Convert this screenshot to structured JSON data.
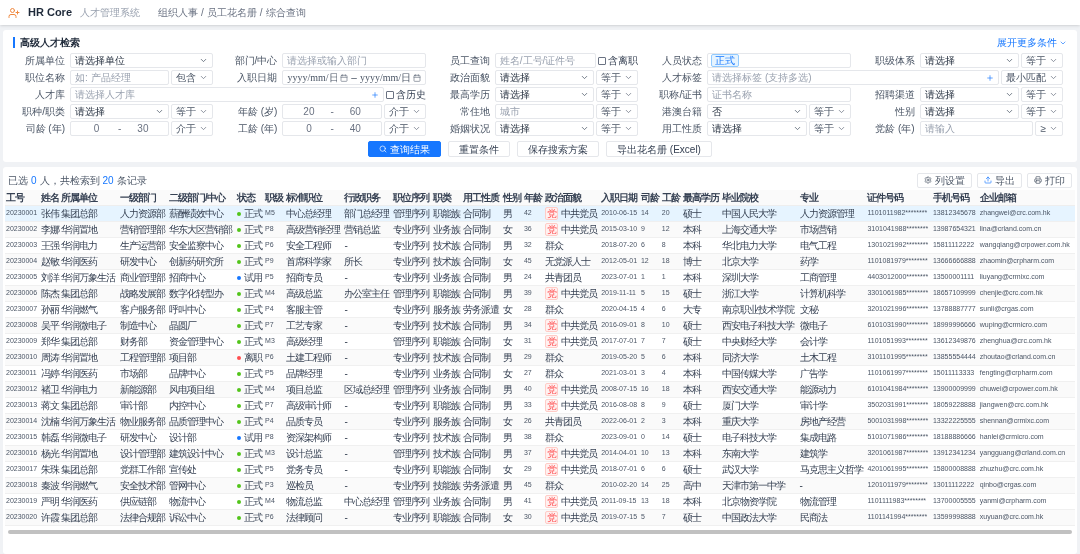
{
  "header": {
    "product": "HR Core",
    "subtitle": "人才管理系统",
    "breadcrumb": [
      "组织人事",
      "员工花名册",
      "综合查询"
    ],
    "separator": "/"
  },
  "search": {
    "title": "高级人才检索",
    "expand_link": "展开更多条件",
    "fields": [
      {
        "label": "所属单位",
        "kind": "select",
        "value": "请选择单位"
      },
      {
        "label": "部门/中心",
        "kind": "input",
        "placeholder": "请选择或输入部门"
      },
      {
        "label": "员工查询",
        "kind": "input",
        "placeholder": "姓名/工号/证件号",
        "checkbox": {
          "label": "含离职",
          "checked": false
        }
      },
      {
        "label": "人员状态",
        "kind": "tags",
        "tags": [
          "正式"
        ]
      },
      {
        "label": "职级体系",
        "kind": "select",
        "value": "请选择",
        "operator": "等于"
      },
      {
        "label": "职位名称",
        "kind": "input",
        "placeholder": "如: 产品经理",
        "operator": "包含"
      },
      {
        "label": "入职日期",
        "kind": "date_range",
        "from_placeholder": "yyyy/mm/日",
        "to_placeholder": "yyyy/mm/日",
        "separator": "–"
      },
      {
        "label": "政治面貌",
        "kind": "select",
        "value": "请选择",
        "operator": "等于"
      },
      {
        "label": "人才标签",
        "kind": "picker",
        "placeholder": "请选择标签 (支持多选)",
        "operator": "最小匹配",
        "wide": true
      },
      {
        "label": "人才库",
        "kind": "picker",
        "placeholder": "请选择人才库",
        "wide": true,
        "checkbox": {
          "label": "含历史",
          "checked": false
        }
      },
      {
        "label": "最高学历",
        "kind": "select",
        "value": "请选择",
        "operator": "等于"
      },
      {
        "label": "职称/证书",
        "kind": "input",
        "placeholder": "证书名称"
      },
      {
        "label": "招聘渠道",
        "kind": "select",
        "value": "请选择",
        "operator": "等于"
      },
      {
        "label": "职种/职类",
        "kind": "select",
        "value": "请选择",
        "operator": "等于"
      },
      {
        "label": "年龄 (岁)",
        "kind": "num_range",
        "from_placeholder": "20",
        "to_placeholder": "60",
        "separator": "-",
        "operator": "介于"
      },
      {
        "label": "常住地",
        "kind": "input",
        "placeholder": "城市",
        "operator": "等于"
      },
      {
        "label": "港澳台籍",
        "kind": "select",
        "value": "否",
        "operator": "等于"
      },
      {
        "label": "性别",
        "kind": "select",
        "value": "请选择",
        "operator": "等于"
      },
      {
        "label": "司龄 (年)",
        "kind": "num_range",
        "from_placeholder": "0",
        "to_placeholder": "30",
        "separator": "-",
        "operator": "介于"
      },
      {
        "label": "工龄 (年)",
        "kind": "num_range",
        "from_placeholder": "0",
        "to_placeholder": "40",
        "separator": "-",
        "operator": "介于"
      },
      {
        "label": "婚姻状况",
        "kind": "select",
        "value": "请选择",
        "operator": "等于"
      },
      {
        "label": "用工性质",
        "kind": "select",
        "value": "请选择",
        "operator": "等于"
      },
      {
        "label": "党龄 (年)",
        "kind": "input",
        "placeholder": "请输入",
        "operator": "≥"
      }
    ],
    "buttons": [
      {
        "label": "查询结果",
        "kind": "primary"
      },
      {
        "label": "重置条件",
        "kind": "default"
      },
      {
        "label": "保存搜索方案",
        "kind": "default"
      },
      {
        "label": "导出花名册 (Excel)",
        "kind": "default"
      }
    ]
  },
  "results": {
    "summary": {
      "prefix": "已选",
      "selected_count": "0",
      "middle": "人，共检索到",
      "total": "20",
      "suffix": "条记录"
    },
    "tools": [
      {
        "label": "列设置",
        "kind": "settings"
      },
      {
        "label": "导出",
        "kind": "export"
      },
      {
        "label": "打印",
        "kind": "print"
      }
    ],
    "columns": [
      {
        "label": "工号",
        "kind": "number"
      },
      {
        "label": "姓名",
        "kind": "text"
      },
      {
        "label": "所属单位",
        "kind": "text"
      },
      {
        "label": "一级部门",
        "kind": "text"
      },
      {
        "label": "二级部门/中心",
        "kind": "text"
      },
      {
        "label": "状态",
        "kind": "status"
      },
      {
        "label": "职级",
        "kind": "number"
      },
      {
        "label": "标准职位",
        "kind": "text"
      },
      {
        "label": "行政职务",
        "kind": "text"
      },
      {
        "label": "职位序列",
        "kind": "text"
      },
      {
        "label": "职类",
        "kind": "text"
      },
      {
        "label": "用工性质",
        "kind": "text"
      },
      {
        "label": "性别",
        "kind": "text"
      },
      {
        "label": "年龄",
        "kind": "number"
      },
      {
        "label": "政治面貌",
        "kind": "political"
      },
      {
        "label": "入职日期",
        "kind": "number"
      },
      {
        "label": "司龄",
        "kind": "number"
      },
      {
        "label": "工龄",
        "kind": "number"
      },
      {
        "label": "最高学历",
        "kind": "text"
      },
      {
        "label": "毕业院校",
        "kind": "text"
      },
      {
        "label": "专业",
        "kind": "text"
      },
      {
        "label": "证件号码",
        "kind": "number"
      },
      {
        "label": "手机号码",
        "kind": "number"
      },
      {
        "label": "企业邮箱",
        "kind": "number"
      }
    ],
    "rows": [
      {
        "selected": true,
        "cells": [
          "20230001",
          "张伟",
          "集团总部",
          "人力资源部",
          "薪酬绩效中心",
          {
            "text": "正式",
            "color": "#52c41a"
          },
          "M5",
          "中心总经理",
          "部门总经理",
          "管理序列",
          "职能族",
          "合同制",
          "男",
          "42",
          {
            "text": "中共党员",
            "badge": "党"
          },
          "2010-06-15",
          "14",
          "20",
          "硕士",
          "中国人民大学",
          "人力资源管理",
          "1101011982********",
          "13812345678",
          "zhangwei@crc.com.hk"
        ]
      },
      {
        "selected": false,
        "cells": [
          "20230002",
          "李娜",
          "华润置地",
          "营销管理部",
          "华东大区营销部",
          {
            "text": "正式",
            "color": "#52c41a"
          },
          "P8",
          "高级营销经理",
          "营销总监",
          "专业序列",
          "业务族",
          "合同制",
          "女",
          "36",
          {
            "text": "中共党员",
            "badge": "党"
          },
          "2015-03-10",
          "9",
          "12",
          "本科",
          "上海交通大学",
          "市场营销",
          "3101041988********",
          "13987654321",
          "lina@crland.com.cn"
        ]
      },
      {
        "selected": false,
        "cells": [
          "20230003",
          "王强",
          "华润电力",
          "生产运营部",
          "安全监察中心",
          {
            "text": "正式",
            "color": "#52c41a"
          },
          "P6",
          "安全工程师",
          "-",
          "专业序列",
          "技术族",
          "合同制",
          "男",
          "32",
          {
            "text": "群众"
          },
          "2018-07-20",
          "6",
          "8",
          "本科",
          "华北电力大学",
          "电气工程",
          "1301021992********",
          "15811112222",
          "wangqiang@crpower.com.hk"
        ]
      },
      {
        "selected": false,
        "cells": [
          "20230004",
          "赵敏",
          "华润医药",
          "研发中心",
          "创新药研究所",
          {
            "text": "正式",
            "color": "#52c41a"
          },
          "P9",
          "首席科学家",
          "所长",
          "专业序列",
          "技术族",
          "合同制",
          "女",
          "45",
          {
            "text": "无党派人士"
          },
          "2012-05-01",
          "12",
          "18",
          "博士",
          "北京大学",
          "药学",
          "1101081979********",
          "13666666888",
          "zhaomin@crpharm.com"
        ]
      },
      {
        "selected": false,
        "cells": [
          "20230005",
          "刘洋",
          "华润万象生活",
          "商业管理部",
          "招商中心",
          {
            "text": "试用",
            "color": "#1677ff"
          },
          "P5",
          "招商专员",
          "-",
          "专业序列",
          "业务族",
          "合同制",
          "男",
          "24",
          {
            "text": "共青团员"
          },
          "2023-07-01",
          "1",
          "1",
          "本科",
          "深圳大学",
          "工商管理",
          "4403012000********",
          "13500001111",
          "liuyang@crmixc.com"
        ]
      },
      {
        "selected": false,
        "cells": [
          "20230006",
          "陈杰",
          "集团总部",
          "战略发展部",
          "数字化转型办",
          {
            "text": "正式",
            "color": "#52c41a"
          },
          "M4",
          "高级总监",
          "办公室主任",
          "管理序列",
          "职能族",
          "合同制",
          "男",
          "39",
          {
            "text": "中共党员",
            "badge": "党"
          },
          "2019-11-11",
          "5",
          "15",
          "硕士",
          "浙江大学",
          "计算机科学",
          "3301061985********",
          "18657109999",
          "chenjie@crc.com.hk"
        ]
      },
      {
        "selected": false,
        "cells": [
          "20230007",
          "孙丽",
          "华润燃气",
          "客户服务部",
          "呼叫中心",
          {
            "text": "正式",
            "color": "#52c41a"
          },
          "P4",
          "客服主管",
          "-",
          "专业序列",
          "服务族",
          "劳务派遣",
          "女",
          "28",
          {
            "text": "群众"
          },
          "2020-04-15",
          "4",
          "6",
          "大专",
          "南京职业技术学院",
          "文秘",
          "3201021996********",
          "13788887777",
          "sunli@crgas.com"
        ]
      },
      {
        "selected": false,
        "cells": [
          "20230008",
          "吴平",
          "华润微电子",
          "制造中心",
          "晶圆厂",
          {
            "text": "正式",
            "color": "#52c41a"
          },
          "P7",
          "工艺专家",
          "-",
          "专业序列",
          "技术族",
          "合同制",
          "男",
          "34",
          {
            "text": "中共党员",
            "badge": "党"
          },
          "2016-09-01",
          "8",
          "10",
          "硕士",
          "西安电子科技大学",
          "微电子",
          "6101031990********",
          "18999996666",
          "wuping@crmicro.com"
        ]
      },
      {
        "selected": false,
        "cells": [
          "20230009",
          "郑华",
          "集团总部",
          "财务部",
          "资金管理中心",
          {
            "text": "正式",
            "color": "#52c41a"
          },
          "M3",
          "高级经理",
          "-",
          "管理序列",
          "职能族",
          "合同制",
          "女",
          "31",
          {
            "text": "中共党员",
            "badge": "党"
          },
          "2017-07-01",
          "7",
          "7",
          "硕士",
          "中央财经大学",
          "会计学",
          "1101051993********",
          "13612349876",
          "zhenghua@crc.com.hk"
        ]
      },
      {
        "selected": false,
        "cells": [
          "20230010",
          "周涛",
          "华润置地",
          "工程管理部",
          "项目部",
          {
            "text": "离职",
            "color": "#ff4d4f"
          },
          "P6",
          "土建工程师",
          "-",
          "专业序列",
          "技术族",
          "合同制",
          "男",
          "29",
          {
            "text": "群众"
          },
          "2019-05-20",
          "5",
          "6",
          "本科",
          "同济大学",
          "土木工程",
          "3101101995********",
          "13855554444",
          "zhoutao@crland.com.cn"
        ]
      },
      {
        "selected": false,
        "cells": [
          "20230011",
          "冯婷",
          "华润医药",
          "市场部",
          "品牌中心",
          {
            "text": "正式",
            "color": "#52c41a"
          },
          "P5",
          "品牌经理",
          "-",
          "专业序列",
          "业务族",
          "合同制",
          "女",
          "27",
          {
            "text": "群众"
          },
          "2021-03-01",
          "3",
          "4",
          "本科",
          "中国传媒大学",
          "广告学",
          "1101061997********",
          "15011113333",
          "fengting@crpharm.com"
        ]
      },
      {
        "selected": false,
        "cells": [
          "20230012",
          "褚卫",
          "华润电力",
          "新能源部",
          "风电项目组",
          {
            "text": "正式",
            "color": "#52c41a"
          },
          "M4",
          "项目总监",
          "区域总经理",
          "管理序列",
          "业务族",
          "合同制",
          "男",
          "40",
          {
            "text": "中共党员",
            "badge": "党"
          },
          "2008-07-15",
          "16",
          "18",
          "本科",
          "西安交通大学",
          "能源动力",
          "6101041984********",
          "13900009999",
          "chuwei@crpower.com.hk"
        ]
      },
      {
        "selected": false,
        "cells": [
          "20230013",
          "蒋文",
          "集团总部",
          "审计部",
          "内控中心",
          {
            "text": "正式",
            "color": "#52c41a"
          },
          "P7",
          "高级审计师",
          "-",
          "专业序列",
          "职能族",
          "合同制",
          "男",
          "33",
          {
            "text": "中共党员",
            "badge": "党"
          },
          "2016-08-08",
          "8",
          "9",
          "硕士",
          "厦门大学",
          "审计学",
          "3502031991********",
          "18059228888",
          "jiangwen@crc.com.hk"
        ]
      },
      {
        "selected": false,
        "cells": [
          "20230014",
          "沈楠",
          "华润万象生活",
          "物业服务部",
          "品质管理中心",
          {
            "text": "正式",
            "color": "#52c41a"
          },
          "P4",
          "品质专员",
          "-",
          "专业序列",
          "服务族",
          "合同制",
          "女",
          "26",
          {
            "text": "共青团员"
          },
          "2022-06-01",
          "2",
          "3",
          "本科",
          "重庆大学",
          "房地产经营",
          "5001031998********",
          "13322225555",
          "shennan@crmixc.com"
        ]
      },
      {
        "selected": false,
        "cells": [
          "20230015",
          "韩磊",
          "华润微电子",
          "研发中心",
          "设计部",
          {
            "text": "试用",
            "color": "#1677ff"
          },
          "P8",
          "资深架构师",
          "-",
          "专业序列",
          "技术族",
          "合同制",
          "男",
          "38",
          {
            "text": "群众"
          },
          "2023-09-01",
          "0",
          "14",
          "硕士",
          "电子科技大学",
          "集成电路",
          "5101071986********",
          "18188886666",
          "hanlei@crmicro.com"
        ]
      },
      {
        "selected": false,
        "cells": [
          "20230016",
          "杨光",
          "华润置地",
          "设计管理部",
          "建筑设计中心",
          {
            "text": "正式",
            "color": "#52c41a"
          },
          "M3",
          "设计总监",
          "-",
          "管理序列",
          "技术族",
          "合同制",
          "男",
          "37",
          {
            "text": "中共党员",
            "badge": "党"
          },
          "2014-04-01",
          "10",
          "13",
          "本科",
          "东南大学",
          "建筑学",
          "3201061987********",
          "13912341234",
          "yangguang@crland.com.cn"
        ]
      },
      {
        "selected": false,
        "cells": [
          "20230017",
          "朱珠",
          "集团总部",
          "党群工作部",
          "宣传处",
          {
            "text": "正式",
            "color": "#52c41a"
          },
          "P5",
          "党务专员",
          "-",
          "专业序列",
          "职能族",
          "合同制",
          "女",
          "29",
          {
            "text": "中共党员",
            "badge": "党"
          },
          "2018-07-01",
          "6",
          "6",
          "硕士",
          "武汉大学",
          "马克思主义哲学",
          "4201061995********",
          "15800008888",
          "zhuzhu@crc.com.hk"
        ]
      },
      {
        "selected": false,
        "cells": [
          "20230018",
          "秦波",
          "华润燃气",
          "安全技术部",
          "管网中心",
          {
            "text": "正式",
            "color": "#52c41a"
          },
          "P3",
          "巡检员",
          "-",
          "专业序列",
          "技能族",
          "劳务派遣",
          "男",
          "45",
          {
            "text": "群众"
          },
          "2010-02-20",
          "14",
          "25",
          "高中",
          "天津市第一中学",
          "-",
          "1201011979********",
          "13011112222",
          "qinbo@crgas.com"
        ]
      },
      {
        "selected": false,
        "cells": [
          "20230019",
          "严明",
          "华润医药",
          "供应链部",
          "物流中心",
          {
            "text": "正式",
            "color": "#52c41a"
          },
          "M4",
          "物流总监",
          "中心总经理",
          "管理序列",
          "业务族",
          "合同制",
          "男",
          "41",
          {
            "text": "中共党员",
            "badge": "党"
          },
          "2011-09-15",
          "13",
          "18",
          "本科",
          "北京物资学院",
          "物流管理",
          "1101111983********",
          "13700005555",
          "yanmi@crpharm.com"
        ]
      },
      {
        "selected": false,
        "cells": [
          "20230020",
          "许霞",
          "集团总部",
          "法律合规部",
          "诉讼中心",
          {
            "text": "正式",
            "color": "#52c41a"
          },
          "P6",
          "法律顾问",
          "-",
          "专业序列",
          "职能族",
          "合同制",
          "女",
          "30",
          {
            "text": "中共党员",
            "badge": "党"
          },
          "2019-07-15",
          "5",
          "7",
          "硕士",
          "中国政法大学",
          "民商法",
          "1101141994********",
          "13599998888",
          "xuyuan@crc.com.hk"
        ]
      }
    ]
  }
}
